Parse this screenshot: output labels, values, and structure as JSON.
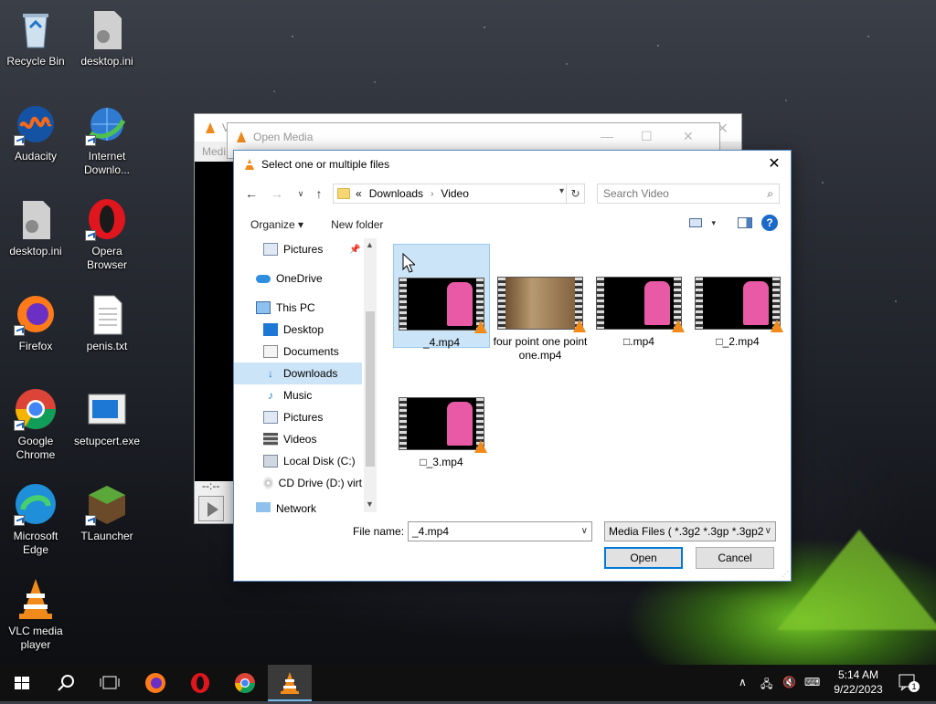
{
  "desktop": {
    "icons": [
      {
        "label": "Recycle Bin"
      },
      {
        "label": "desktop.ini"
      },
      {
        "label": "Audacity"
      },
      {
        "label": "Internet Downlo..."
      },
      {
        "label": "desktop.ini"
      },
      {
        "label": "Opera Browser"
      },
      {
        "label": "Firefox"
      },
      {
        "label": "penis.txt"
      },
      {
        "label": "Google Chrome"
      },
      {
        "label": "setupcert.exe"
      },
      {
        "label": "Microsoft Edge"
      },
      {
        "label": "TLauncher"
      },
      {
        "label": "VLC media player"
      }
    ]
  },
  "vlc_window": {
    "title": "V",
    "menu": "Medi",
    "time": "--:--"
  },
  "open_media": {
    "title": "Open Media"
  },
  "dialog": {
    "title": "Select one or multiple files",
    "address": {
      "prefix": "«",
      "crumbs": [
        "Downloads",
        "Video"
      ]
    },
    "search_placeholder": "Search Video",
    "toolbar": {
      "organize": "Organize ▾",
      "new_folder": "New folder"
    },
    "nav_items": [
      {
        "label": "Pictures",
        "pinned": true
      },
      {
        "label": "OneDrive"
      },
      {
        "label": "This PC"
      },
      {
        "label": "Desktop"
      },
      {
        "label": "Documents"
      },
      {
        "label": "Downloads",
        "selected": true
      },
      {
        "label": "Music"
      },
      {
        "label": "Pictures"
      },
      {
        "label": "Videos"
      },
      {
        "label": "Local Disk (C:)"
      },
      {
        "label": "CD Drive (D:) virt"
      },
      {
        "label": "Network"
      }
    ],
    "files": [
      {
        "name": "_4.mp4",
        "selected": true
      },
      {
        "name": "four point one point one.mp4"
      },
      {
        "name": "□.mp4"
      },
      {
        "name": "□_2.mp4"
      },
      {
        "name": "□_3.mp4"
      }
    ],
    "file_name_label": "File name:",
    "file_name_value": "_4.mp4",
    "file_type": "Media Files ( *.3g2 *.3gp *.3gp2",
    "open_button": "Open",
    "cancel_button": "Cancel"
  },
  "taskbar": {
    "time": "5:14 AM",
    "date": "9/22/2023",
    "notification_count": "1"
  },
  "colors": {
    "accent": "#0078d7",
    "selection": "#cce4f7",
    "taskbar": "#101010"
  }
}
